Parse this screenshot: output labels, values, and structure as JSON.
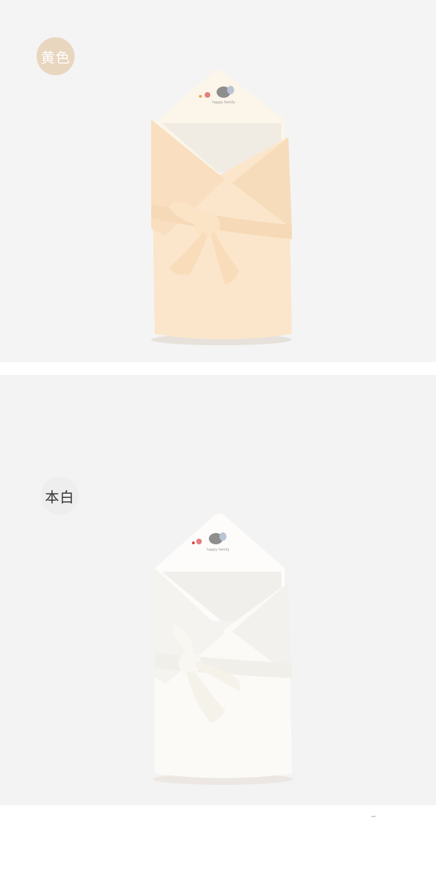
{
  "variants": [
    {
      "label": "黄色",
      "swatch_color": "#e8d6bf",
      "label_color": "#ffffff",
      "blanket_color": "#fbe6cc",
      "hood_color": "#fbf5ea",
      "tie_color": "#fbe3c6",
      "icon": "swaddle-blanket-icon"
    },
    {
      "label": "本白",
      "swatch_color": "#eeeeee",
      "label_color": "#333333",
      "blanket_color": "#fbfaf7",
      "hood_color": "#fdfcfa",
      "tie_color": "#f9f7f1",
      "icon": "swaddle-blanket-icon"
    }
  ],
  "embroidery": {
    "text": "happy family",
    "elephant_color": "#8e8e8e",
    "accent_color": "#e57d7d"
  }
}
